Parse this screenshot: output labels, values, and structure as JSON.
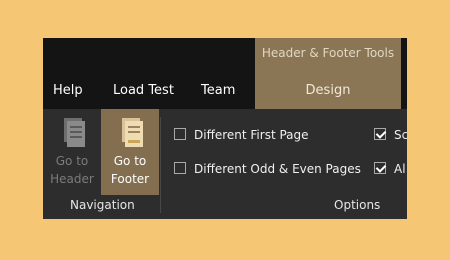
{
  "context_group": {
    "title": "Header & Footer Tools",
    "tab": "Design"
  },
  "tabs": [
    "Help",
    "Load Test",
    "Team"
  ],
  "navigation": {
    "go_to_header": "Go to\nHeader",
    "go_to_footer": "Go to\nFooter",
    "group_label": "Navigation"
  },
  "options": {
    "different_first_page": {
      "label": "Different First Page",
      "checked": false
    },
    "different_odd_even": {
      "label": "Different Odd & Even Pages",
      "checked": false
    },
    "right_check_1": {
      "label": "Sc",
      "checked": true
    },
    "right_check_2": {
      "label": "Al",
      "checked": true
    },
    "group_label": "Options"
  },
  "colors": {
    "background": "#f5c674",
    "context_tab": "#8a7655",
    "active_button": "#836f50"
  }
}
